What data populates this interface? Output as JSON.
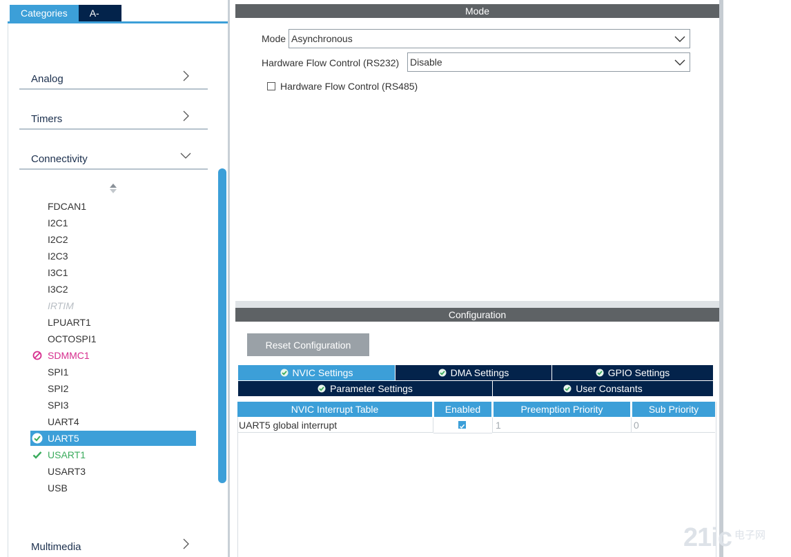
{
  "left": {
    "tabs": [
      {
        "label": "Categories",
        "active": true
      },
      {
        "label": "A->Z",
        "active": false
      }
    ],
    "categories": {
      "analog": "Analog",
      "timers": "Timers",
      "connectivity": "Connectivity",
      "multimedia": "Multimedia"
    },
    "peripherals": [
      {
        "name": "FDCAN1",
        "state": "normal"
      },
      {
        "name": "I2C1",
        "state": "normal"
      },
      {
        "name": "I2C2",
        "state": "normal"
      },
      {
        "name": "I2C3",
        "state": "normal"
      },
      {
        "name": "I3C1",
        "state": "normal"
      },
      {
        "name": "I3C2",
        "state": "normal"
      },
      {
        "name": "IRTIM",
        "state": "disabled"
      },
      {
        "name": "LPUART1",
        "state": "normal"
      },
      {
        "name": "OCTOSPI1",
        "state": "normal"
      },
      {
        "name": "SDMMC1",
        "state": "error"
      },
      {
        "name": "SPI1",
        "state": "normal"
      },
      {
        "name": "SPI2",
        "state": "normal"
      },
      {
        "name": "SPI3",
        "state": "normal"
      },
      {
        "name": "UART4",
        "state": "normal"
      },
      {
        "name": "UART5",
        "state": "selected"
      },
      {
        "name": "USART1",
        "state": "ok"
      },
      {
        "name": "USART3",
        "state": "normal"
      },
      {
        "name": "USB",
        "state": "normal"
      }
    ]
  },
  "mode": {
    "header": "Mode",
    "mode_label": "Mode",
    "mode_value": "Asynchronous",
    "hwfc_label": "Hardware Flow Control (RS232)",
    "hwfc_value": "Disable",
    "rs485_label": "Hardware Flow Control (RS485)",
    "rs485_checked": false
  },
  "config": {
    "header": "Configuration",
    "reset_label": "Reset Configuration",
    "tabs_row1": [
      {
        "label": "NVIC Settings",
        "active": true
      },
      {
        "label": "DMA Settings",
        "active": false
      },
      {
        "label": "GPIO Settings",
        "active": false
      }
    ],
    "tabs_row2": [
      {
        "label": "Parameter Settings",
        "active": false
      },
      {
        "label": "User Constants",
        "active": false
      }
    ],
    "table": {
      "headers": [
        "NVIC Interrupt Table",
        "Enabled",
        "Preemption Priority",
        "Sub Priority"
      ],
      "rows": [
        {
          "name": "UART5 global interrupt",
          "enabled": true,
          "preemption": "1",
          "sub": "0"
        }
      ]
    }
  },
  "watermark": {
    "main": "21ic",
    "sub": "电子网"
  },
  "colors": {
    "accent": "#3c9fd8",
    "navy": "#03234b",
    "header_gray": "#5e6265",
    "ok_green": "#3aab5c",
    "error_pink": "#d62e8e"
  }
}
